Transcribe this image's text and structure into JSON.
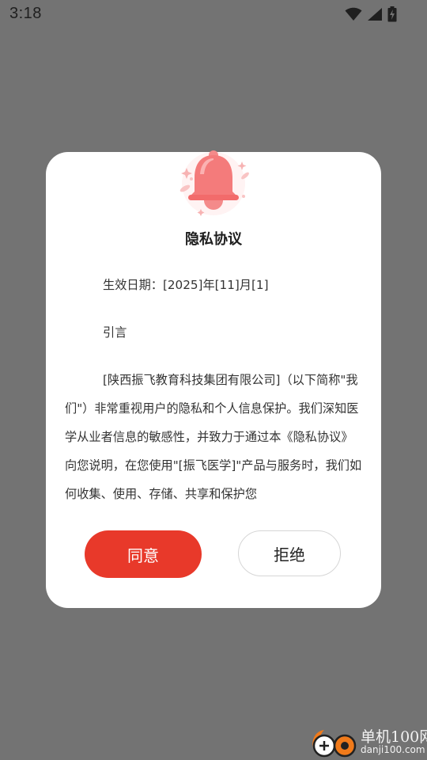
{
  "status_bar": {
    "time": "3:18",
    "icons": [
      "wifi-icon",
      "cellular-signal-icon",
      "battery-charging-icon"
    ]
  },
  "dialog": {
    "title": "隐私协议",
    "icon": "bell-icon",
    "paragraphs": [
      "生效日期：[2025]年[11]月[1]",
      "引言",
      "[陕西振飞教育科技集团有限公司]（以下简称\"我们\"）非常重视用户的隐私和个人信息保护。我们深知医学从业者信息的敏感性，并致力于通过本《隐私协议》向您说明，在您使用\"[振飞医学]\"产品与服务时，我们如何收集、使用、存储、共享和保护您"
    ],
    "agree_label": "同意",
    "refuse_label": "拒绝"
  },
  "colors": {
    "overlay": "#737373",
    "accent": "#e8392a",
    "bell": "#f47b7b"
  },
  "watermark": {
    "site_name": "单机100网",
    "site_url": "danji100.com"
  }
}
